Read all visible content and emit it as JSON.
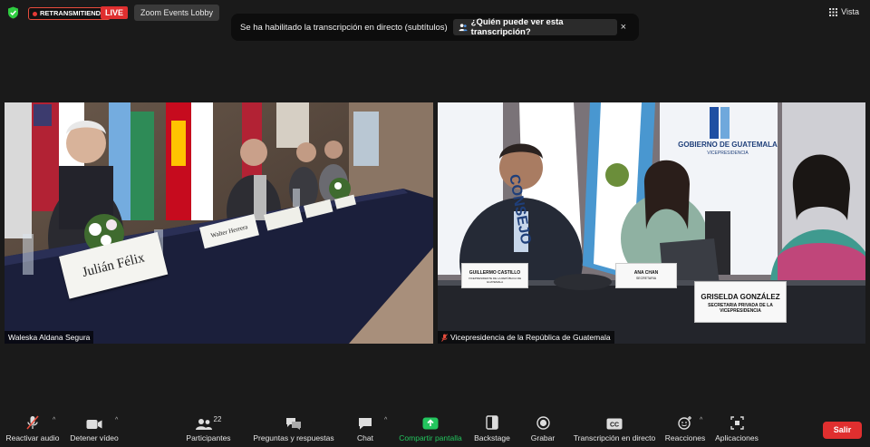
{
  "topbar": {
    "recording_badge": "RETRANSMITIENDO",
    "live_badge": "LIVE",
    "lobby_button": "Zoom Events Lobby",
    "view_button": "Vista"
  },
  "banner": {
    "message": "Se ha habilitado la transcripción en directo (subtítulos)",
    "who_button": "¿Quién puede ver esta transcripción?",
    "close": "×"
  },
  "tiles": [
    {
      "name": "Waleska Aldana Segura",
      "placards": [
        "Julián Félix",
        "Walter Herrera"
      ]
    },
    {
      "name": "Vicepresidencia de la República de Guatemala",
      "placards": [
        "GUILLERMO CASTILLO",
        "ANA CHAN",
        "GRISELDA GONZÁLEZ"
      ],
      "placard_subtitles": [
        "VICEPRESIDENTE DE LA REPÚBLICA DE GUATEMALA",
        "SECRETARIA",
        "SECRETARIA PRIVADA DE LA VICEPRESIDENCIA"
      ],
      "backdrop_title": "GOBIERNO DE GUATEMALA",
      "backdrop_subtitle": "VICEPRESIDENCIA",
      "backdrop_word": "CONSEJO"
    }
  ],
  "toolbar": {
    "audio": "Reactivar audio",
    "video": "Detener vídeo",
    "participants": "Participantes",
    "participants_count": "22",
    "qa": "Preguntas y respuestas",
    "chat": "Chat",
    "share": "Compartir pantalla",
    "backstage": "Backstage",
    "record": "Grabar",
    "transcript": "Transcripción en directo",
    "reactions": "Reacciones",
    "apps": "Aplicaciones",
    "leave": "Salir"
  },
  "colors": {
    "live": "#e02f2f",
    "share": "#23c55e",
    "background": "#1a1a1a"
  }
}
